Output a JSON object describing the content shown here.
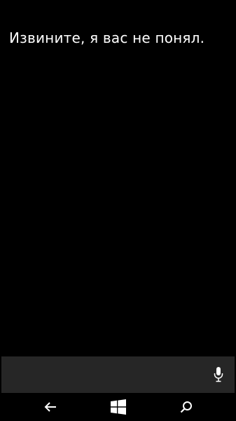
{
  "assistant": {
    "message": "Извините, я вас не понял."
  },
  "input_bar": {
    "mic_icon": "microphone-icon"
  },
  "navbar": {
    "back_icon": "back-arrow-icon",
    "start_icon": "windows-logo-icon",
    "search_icon": "search-icon"
  },
  "colors": {
    "background": "#000000",
    "input_bar": "#262626",
    "text": "#ffffff"
  }
}
